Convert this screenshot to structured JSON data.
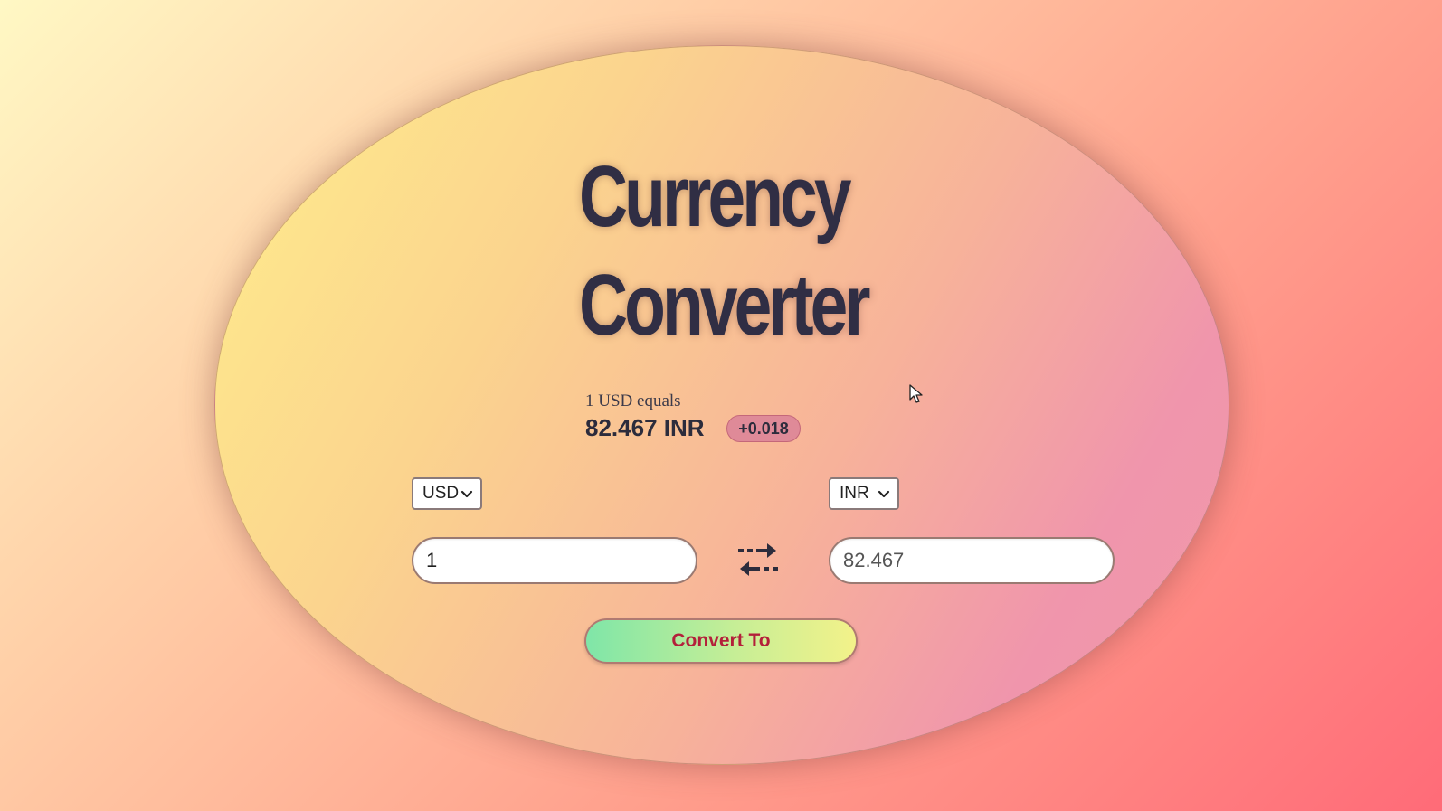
{
  "converter": {
    "title_line1": "Currency",
    "title_line2": "Converter",
    "rate_label": "1 USD equals",
    "rate_value": "82.467 INR",
    "rate_change": "+0.018"
  },
  "from": {
    "currency": "USD",
    "amount": "1"
  },
  "to": {
    "currency": "INR",
    "amount": "82.467"
  },
  "actions": {
    "convert_label": "Convert To",
    "swap_icon": "swap-arrows-icon"
  },
  "colors": {
    "title": "#302e44",
    "convert_text": "#b3203a",
    "badge": "#df8a98"
  }
}
